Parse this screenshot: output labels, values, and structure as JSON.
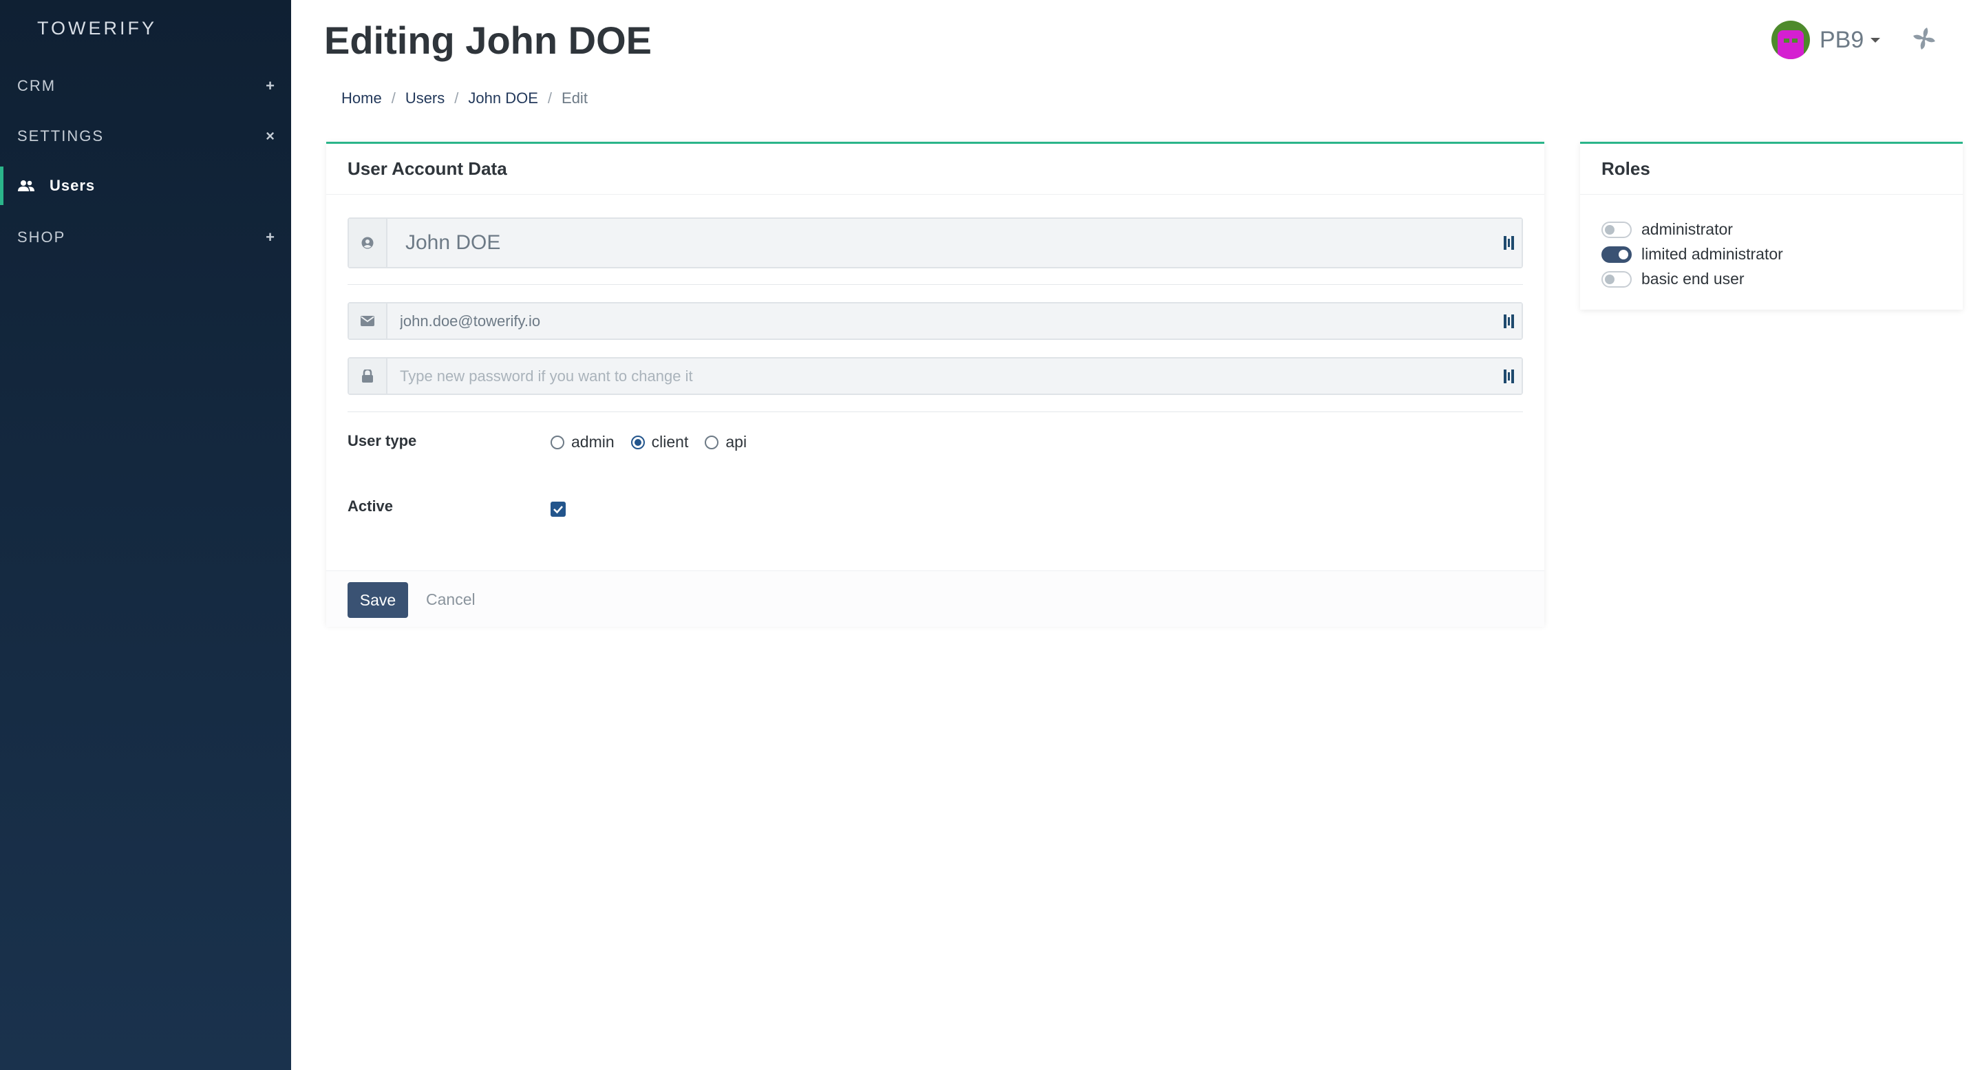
{
  "sidebar": {
    "brand": "TOWERIFY",
    "sections": [
      {
        "label": "CRM",
        "symbol": "+"
      },
      {
        "label": "SETTINGS",
        "symbol": "×"
      },
      {
        "label": "SHOP",
        "symbol": "+"
      }
    ],
    "active_item": {
      "label": "Users",
      "icon": "users-icon"
    }
  },
  "header": {
    "title": "Editing John DOE",
    "breadcrumb": [
      "Home",
      "Users",
      "John DOE",
      "Edit"
    ],
    "user": {
      "name": "PB9",
      "avatar": "avatar-icon"
    },
    "app_icon": "fan-icon"
  },
  "account_card": {
    "title": "User Account Data",
    "name_value": "John DOE",
    "email_value": "john.doe@towerify.io",
    "password_placeholder": "Type new password if you want to change it",
    "user_type_label": "User type",
    "user_type_options": [
      "admin",
      "client",
      "api"
    ],
    "user_type_selected": "client",
    "active_label": "Active",
    "active_checked": true,
    "save_label": "Save",
    "cancel_label": "Cancel"
  },
  "roles_card": {
    "title": "Roles",
    "roles": [
      {
        "label": "administrator",
        "enabled": false
      },
      {
        "label": "limited administrator",
        "enabled": true
      },
      {
        "label": "basic end user",
        "enabled": false
      }
    ]
  },
  "colors": {
    "sidebar_top": "#0f2033",
    "sidebar_bottom": "#1a324d",
    "accent_green": "#2bb58a",
    "primary_blue": "#3a5273"
  }
}
